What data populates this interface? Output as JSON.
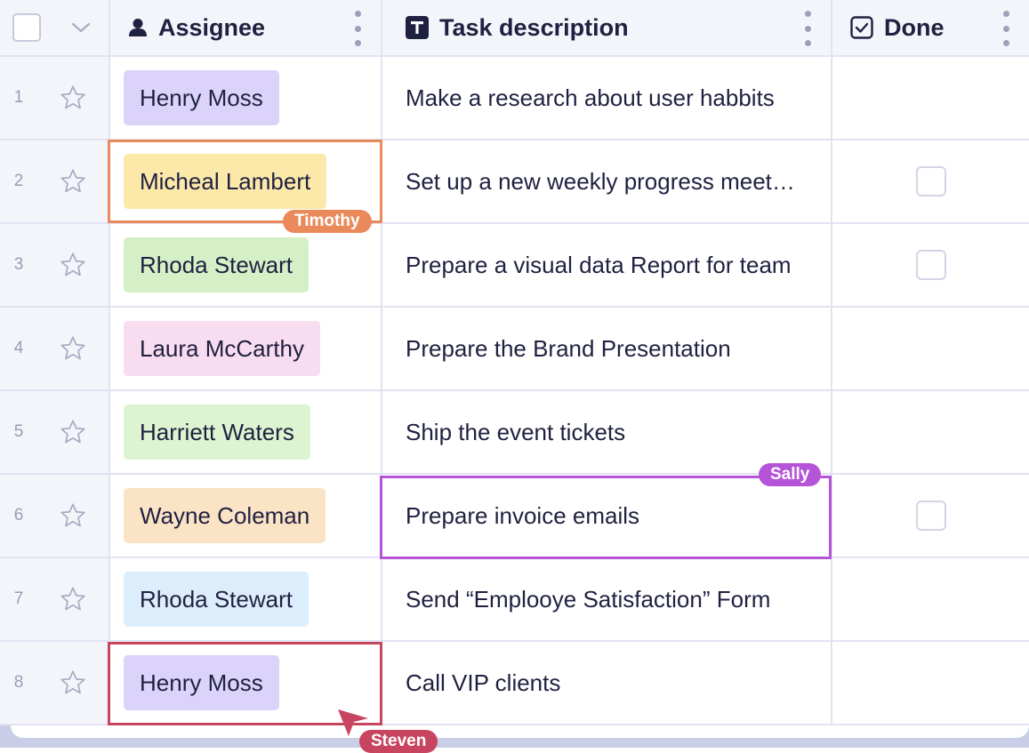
{
  "header": {
    "assignee_label": "Assignee",
    "task_label": "Task description",
    "done_label": "Done"
  },
  "rows": [
    {
      "num": "1",
      "assignee": "Henry Moss",
      "tag_color": "#dbd3fa",
      "task": "Make a research about user habbits",
      "done_checkbox": false
    },
    {
      "num": "2",
      "assignee": "Micheal Lambert",
      "tag_color": "#fce9a9",
      "task": "Set up a new weekly progress meet…",
      "done_checkbox": true
    },
    {
      "num": "3",
      "assignee": "Rhoda Stewart",
      "tag_color": "#d5f0c6",
      "task": "Prepare a visual data Report for team",
      "done_checkbox": true
    },
    {
      "num": "4",
      "assignee": "Laura McCarthy",
      "tag_color": "#f8dcef",
      "task": "Prepare the Brand Presentation",
      "done_checkbox": false
    },
    {
      "num": "5",
      "assignee": "Harriett Waters",
      "tag_color": "#dcf4d0",
      "task": "Ship the event tickets",
      "done_checkbox": false
    },
    {
      "num": "6",
      "assignee": "Wayne Coleman",
      "tag_color": "#fbe3c6",
      "task": "Prepare invoice emails",
      "done_checkbox": true
    },
    {
      "num": "7",
      "assignee": "Rhoda Stewart",
      "tag_color": "#dcedfb",
      "task": "Send “Emplooye Satisfaction” Form",
      "done_checkbox": false
    },
    {
      "num": "8",
      "assignee": "Henry Moss",
      "tag_color": "#dbd3fa",
      "task": "Call VIP clients",
      "done_checkbox": false
    }
  ],
  "collaborators": [
    {
      "name": "Timothy",
      "color": "#ea8a5b"
    },
    {
      "name": "Sally",
      "color": "#b554d8"
    },
    {
      "name": "Steven",
      "color": "#c8455f"
    }
  ],
  "icons": {
    "header_select_all": "checkbox-icon",
    "header_chevron": "chevron-down-icon",
    "assignee_column": "person-icon",
    "task_column": "text-T-icon",
    "done_column": "checkbox-checked-icon",
    "row_star": "star-outline-icon",
    "column_menu": "kebab-menu-icon",
    "cursor": "pointer-arrow-icon"
  }
}
